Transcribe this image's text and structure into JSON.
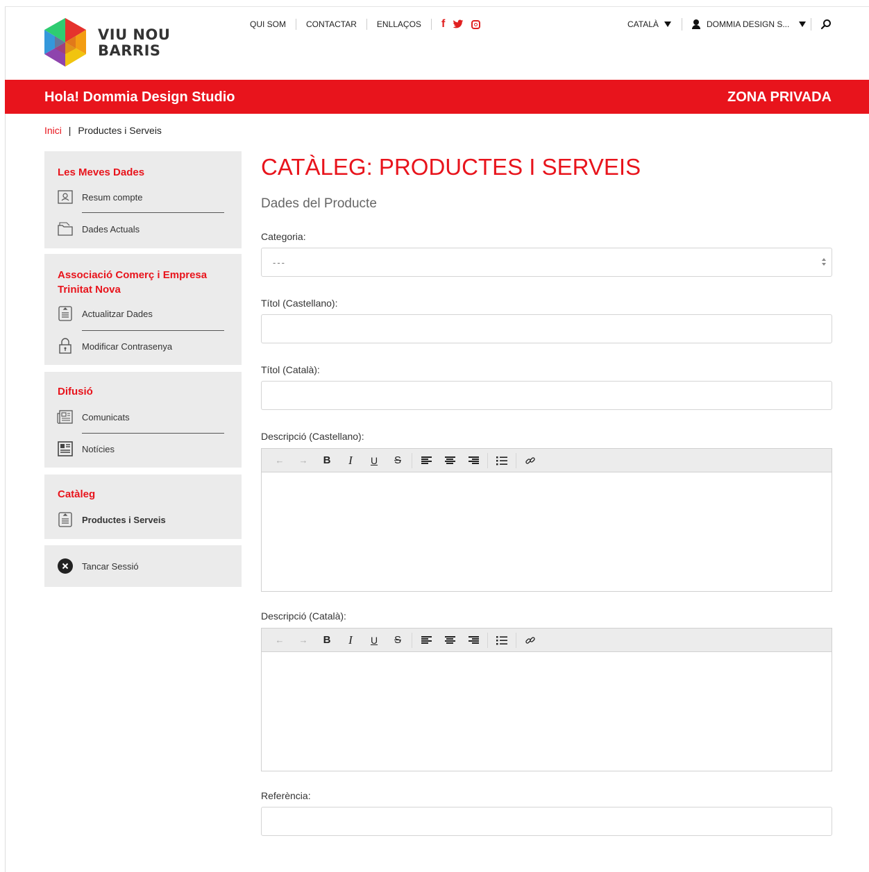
{
  "brand": {
    "line1": "VIU NOU",
    "line2": "BARRIS"
  },
  "topnav": {
    "links": [
      "QUI SOM",
      "CONTACTAR",
      "ENLLAÇOS"
    ],
    "social": [
      "facebook-icon",
      "twitter-icon",
      "instagram-icon"
    ]
  },
  "language": {
    "selected": "CATALÀ"
  },
  "user": {
    "name": "DOMMIA DESIGN S..."
  },
  "redbar": {
    "greeting": "Hola! Dommia Design Studio",
    "zone": "ZONA PRIVADA"
  },
  "breadcrumb": {
    "home": "Inici",
    "separator": "|",
    "current": "Productes i Serveis"
  },
  "sidebar": {
    "groups": [
      {
        "title": "Les Meves Dades",
        "items": [
          {
            "label": "Resum compte",
            "icon": "account-summary-icon"
          },
          {
            "label": "Dades Actuals",
            "icon": "folder-icon"
          }
        ]
      },
      {
        "title": "Associació Comerç i Empresa Trinitat Nova",
        "items": [
          {
            "label": "Actualitzar Dades",
            "icon": "document-icon"
          },
          {
            "label": "Modificar Contrasenya",
            "icon": "lock-icon"
          }
        ]
      },
      {
        "title": "Difusió",
        "items": [
          {
            "label": "Comunicats",
            "icon": "newspaper-icon"
          },
          {
            "label": "Notícies",
            "icon": "news-icon"
          }
        ]
      },
      {
        "title": "Catàleg",
        "items": [
          {
            "label": "Productes i Serveis",
            "icon": "document-icon"
          }
        ]
      }
    ],
    "logout": "Tancar Sessió"
  },
  "main": {
    "title": "CATÀLEG: PRODUCTES I SERVEIS",
    "subtitle": "Dades del Producte",
    "category": {
      "label": "Categoria:",
      "value": "---"
    },
    "title_es": {
      "label": "Títol (Castellano):",
      "value": ""
    },
    "title_ca": {
      "label": "Títol (Català):",
      "value": ""
    },
    "desc_es": {
      "label": "Descripció (Castellano):",
      "value": ""
    },
    "desc_ca": {
      "label": "Descripció (Català):",
      "value": ""
    },
    "reference": {
      "label": "Referència:",
      "value": ""
    },
    "toolbar": {
      "bold": "B",
      "italic": "I",
      "underline": "U",
      "strike": "S",
      "undo": "←",
      "redo": "→"
    }
  },
  "colors": {
    "accent": "#e8141c",
    "panel": "#ebebeb"
  }
}
